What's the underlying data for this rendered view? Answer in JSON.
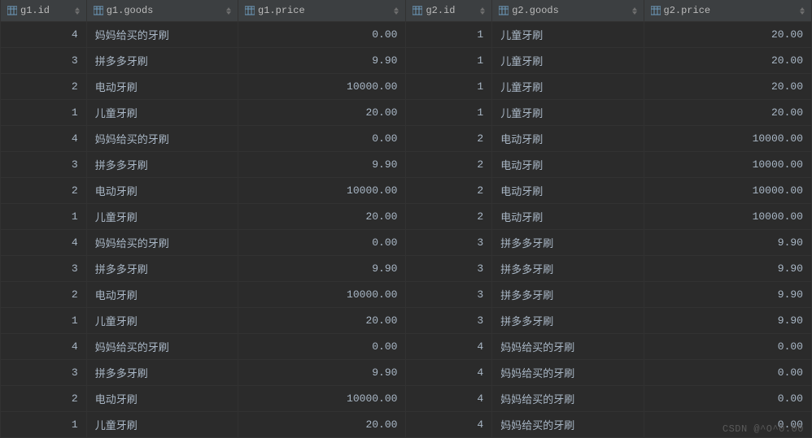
{
  "columns": [
    {
      "label": "g1.id",
      "class": "id-col"
    },
    {
      "label": "g1.goods",
      "class": "goods-col"
    },
    {
      "label": "g1.price",
      "class": "price-col"
    },
    {
      "label": "g2.id",
      "class": "id-col"
    },
    {
      "label": "g2.goods",
      "class": "goods-col"
    },
    {
      "label": "g2.price",
      "class": "price-col"
    }
  ],
  "rows": [
    {
      "g1_id": "4",
      "g1_goods": "妈妈给买的牙刷",
      "g1_price": "0.00",
      "g2_id": "1",
      "g2_goods": "儿童牙刷",
      "g2_price": "20.00"
    },
    {
      "g1_id": "3",
      "g1_goods": "拼多多牙刷",
      "g1_price": "9.90",
      "g2_id": "1",
      "g2_goods": "儿童牙刷",
      "g2_price": "20.00"
    },
    {
      "g1_id": "2",
      "g1_goods": "电动牙刷",
      "g1_price": "10000.00",
      "g2_id": "1",
      "g2_goods": "儿童牙刷",
      "g2_price": "20.00"
    },
    {
      "g1_id": "1",
      "g1_goods": "儿童牙刷",
      "g1_price": "20.00",
      "g2_id": "1",
      "g2_goods": "儿童牙刷",
      "g2_price": "20.00"
    },
    {
      "g1_id": "4",
      "g1_goods": "妈妈给买的牙刷",
      "g1_price": "0.00",
      "g2_id": "2",
      "g2_goods": "电动牙刷",
      "g2_price": "10000.00"
    },
    {
      "g1_id": "3",
      "g1_goods": "拼多多牙刷",
      "g1_price": "9.90",
      "g2_id": "2",
      "g2_goods": "电动牙刷",
      "g2_price": "10000.00"
    },
    {
      "g1_id": "2",
      "g1_goods": "电动牙刷",
      "g1_price": "10000.00",
      "g2_id": "2",
      "g2_goods": "电动牙刷",
      "g2_price": "10000.00"
    },
    {
      "g1_id": "1",
      "g1_goods": "儿童牙刷",
      "g1_price": "20.00",
      "g2_id": "2",
      "g2_goods": "电动牙刷",
      "g2_price": "10000.00"
    },
    {
      "g1_id": "4",
      "g1_goods": "妈妈给买的牙刷",
      "g1_price": "0.00",
      "g2_id": "3",
      "g2_goods": "拼多多牙刷",
      "g2_price": "9.90"
    },
    {
      "g1_id": "3",
      "g1_goods": "拼多多牙刷",
      "g1_price": "9.90",
      "g2_id": "3",
      "g2_goods": "拼多多牙刷",
      "g2_price": "9.90"
    },
    {
      "g1_id": "2",
      "g1_goods": "电动牙刷",
      "g1_price": "10000.00",
      "g2_id": "3",
      "g2_goods": "拼多多牙刷",
      "g2_price": "9.90"
    },
    {
      "g1_id": "1",
      "g1_goods": "儿童牙刷",
      "g1_price": "20.00",
      "g2_id": "3",
      "g2_goods": "拼多多牙刷",
      "g2_price": "9.90"
    },
    {
      "g1_id": "4",
      "g1_goods": "妈妈给买的牙刷",
      "g1_price": "0.00",
      "g2_id": "4",
      "g2_goods": "妈妈给买的牙刷",
      "g2_price": "0.00"
    },
    {
      "g1_id": "3",
      "g1_goods": "拼多多牙刷",
      "g1_price": "9.90",
      "g2_id": "4",
      "g2_goods": "妈妈给买的牙刷",
      "g2_price": "0.00"
    },
    {
      "g1_id": "2",
      "g1_goods": "电动牙刷",
      "g1_price": "10000.00",
      "g2_id": "4",
      "g2_goods": "妈妈给买的牙刷",
      "g2_price": "0.00"
    },
    {
      "g1_id": "1",
      "g1_goods": "儿童牙刷",
      "g1_price": "20.00",
      "g2_id": "4",
      "g2_goods": "妈妈给买的牙刷",
      "g2_price": "0.00"
    }
  ],
  "watermark": "CSDN @^O^0.00"
}
